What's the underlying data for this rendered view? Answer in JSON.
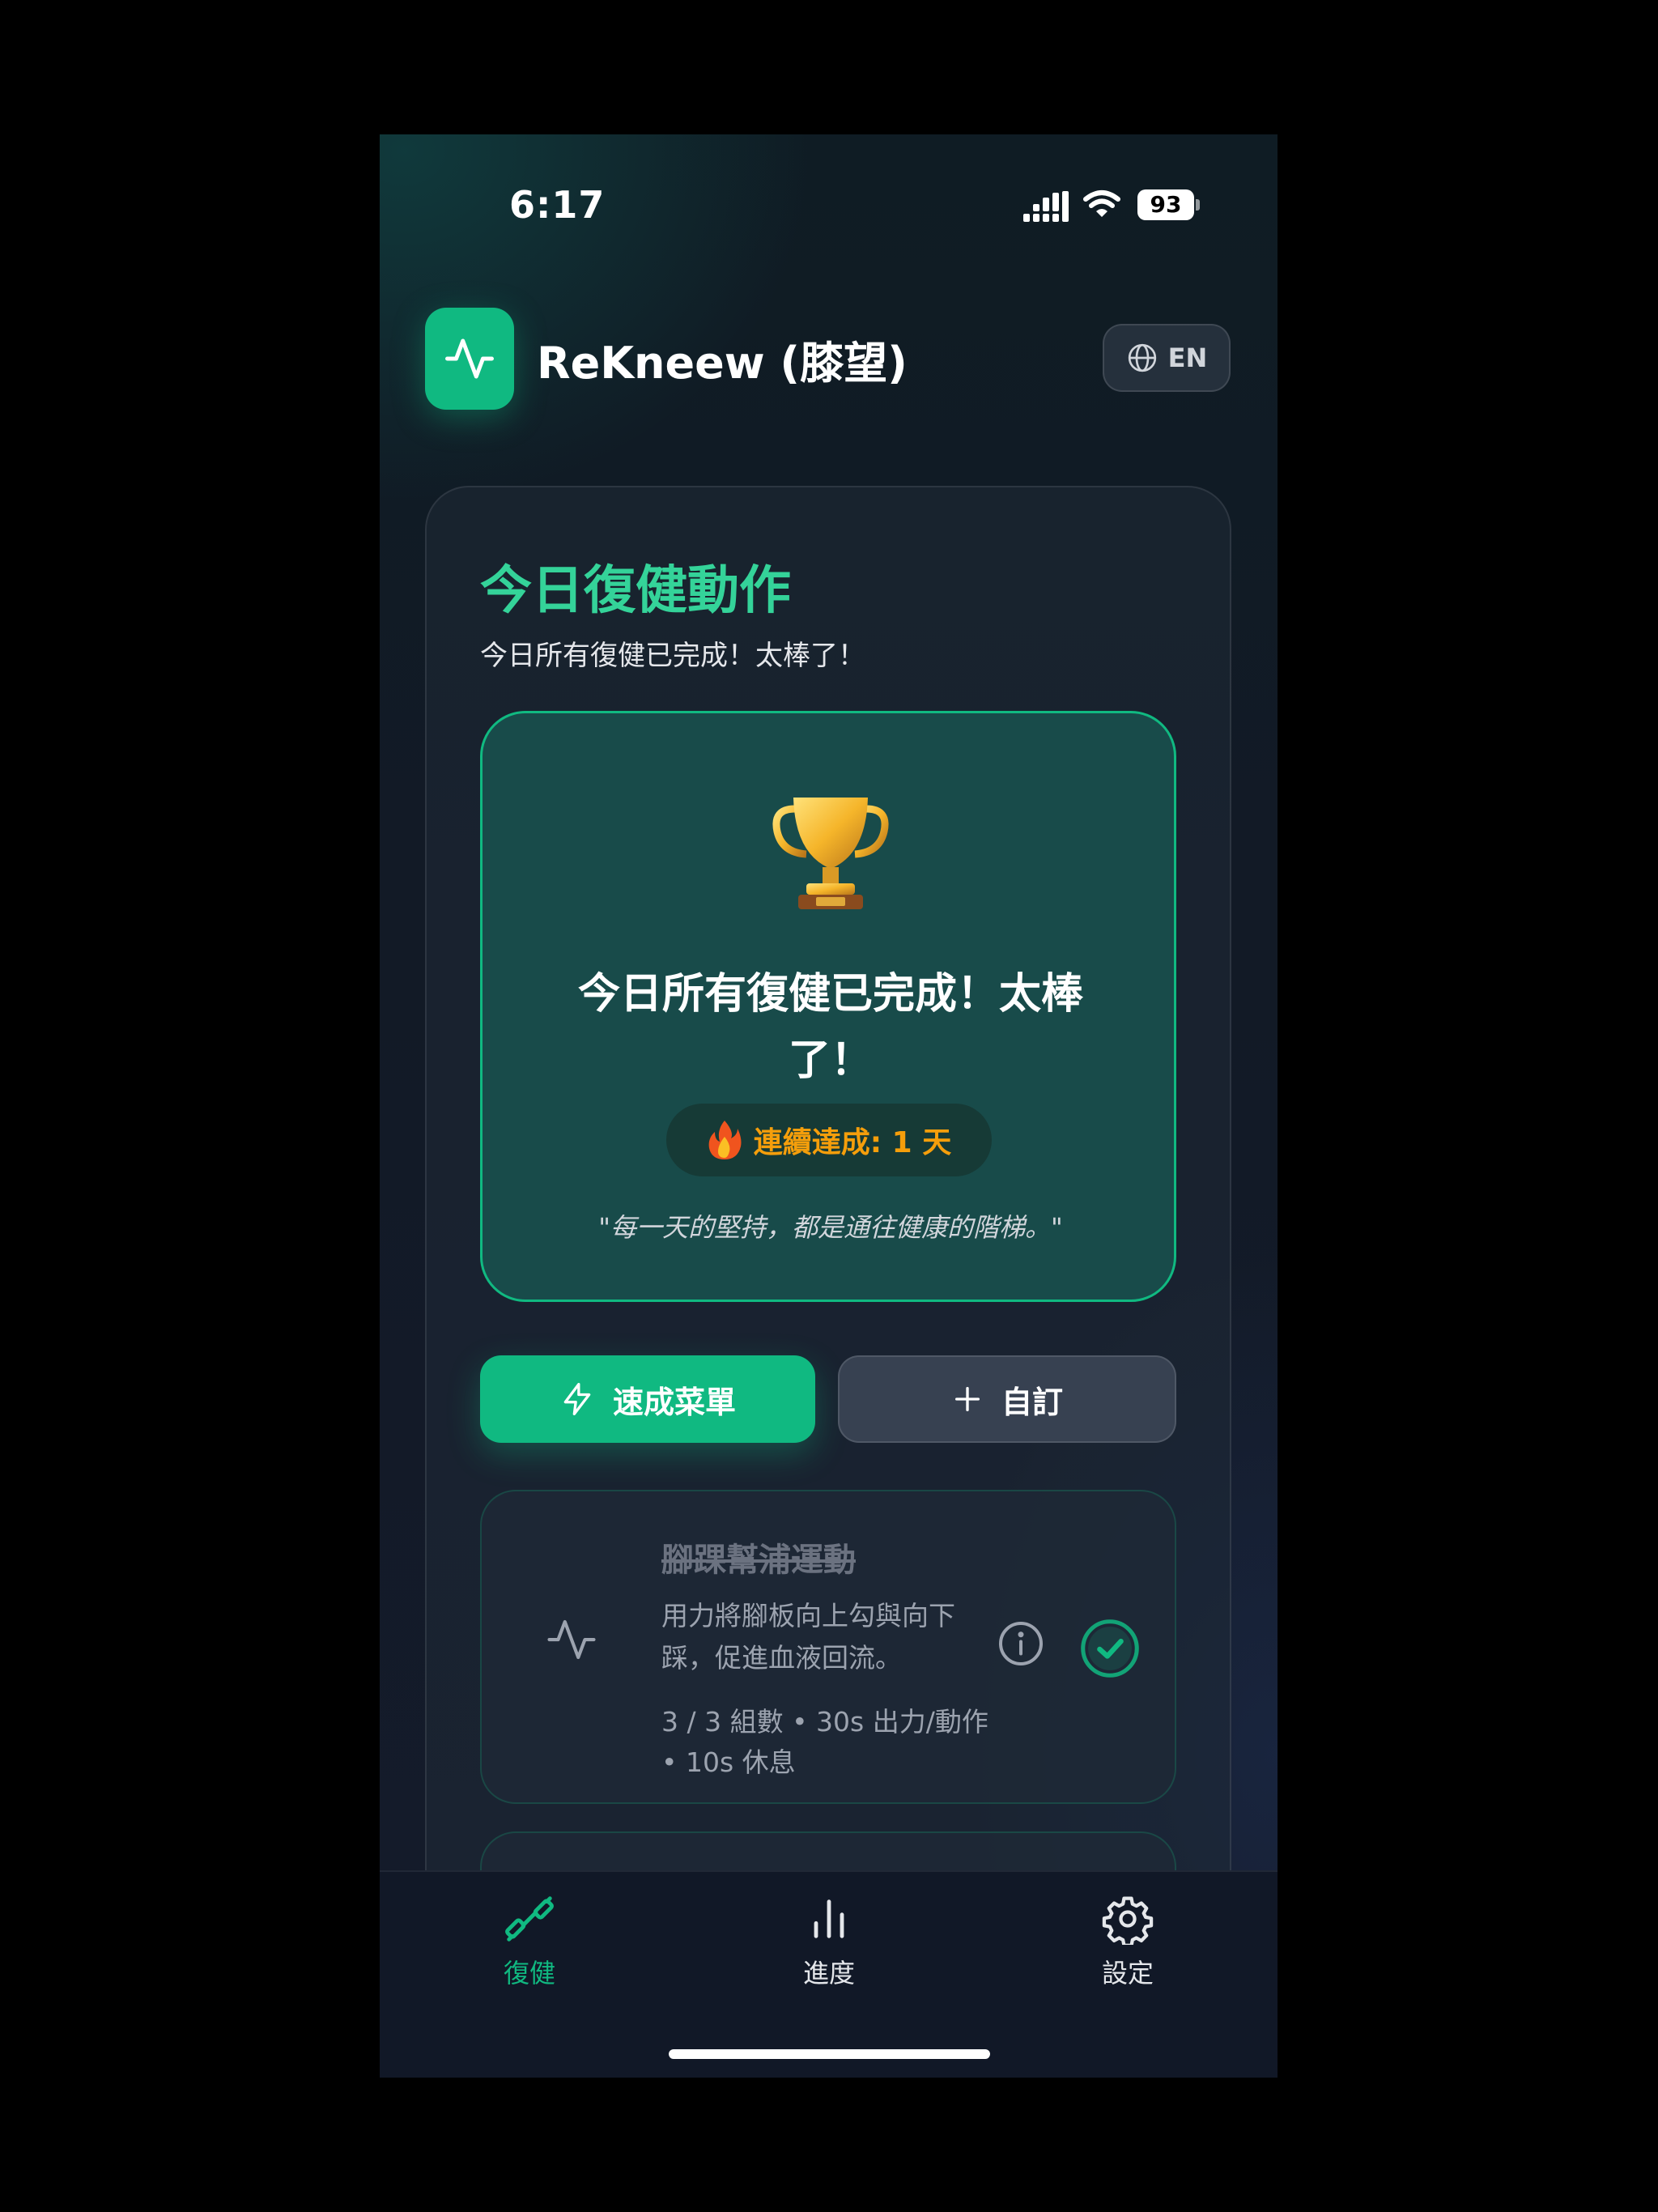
{
  "status_bar": {
    "time": "6:17",
    "battery": "93"
  },
  "header": {
    "app_title": "ReKneew (膝望)",
    "language_label": "EN"
  },
  "main": {
    "title": "今日復健動作",
    "subtitle": "今日所有復健已完成！太棒了！",
    "celebration": {
      "title": "今日所有復健已完成！太棒了！",
      "streak_label": "連續達成: 1 天",
      "quote": "\"每一天的堅持，都是通往健康的階梯。\""
    },
    "actions": {
      "quick_menu_label": "速成菜單",
      "custom_label": "自訂"
    },
    "exercises": [
      {
        "name": "腳踝幫浦運動",
        "description": "用力將腳板向上勾與向下踩，促進血液回流。",
        "meta": "3 / 3 組數 • 30s 出力/動作 • 10s 休息",
        "completed": true
      }
    ]
  },
  "tab_bar": {
    "items": [
      {
        "label": "復健",
        "icon": "dumbbell-icon",
        "active": true
      },
      {
        "label": "進度",
        "icon": "bar-chart-icon",
        "active": false
      },
      {
        "label": "設定",
        "icon": "gear-icon",
        "active": false
      }
    ]
  },
  "colors": {
    "accent": "#10b981",
    "accent_text": "#34d399",
    "streak": "#f59e0b",
    "background": "#121a26"
  }
}
